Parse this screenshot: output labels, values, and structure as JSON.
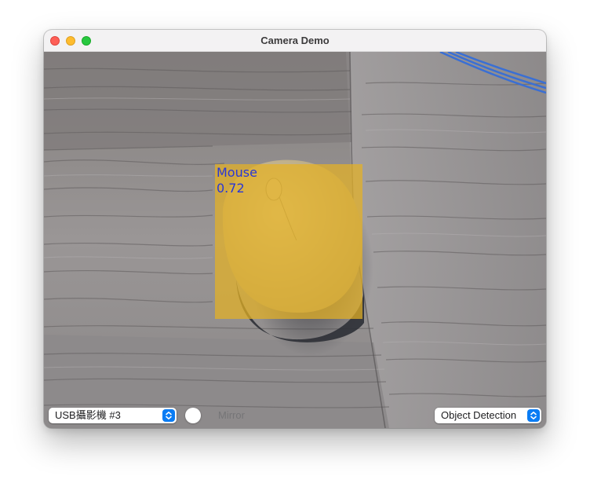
{
  "window": {
    "title": "Camera Demo"
  },
  "camera_view": {
    "detection": {
      "label": "Mouse",
      "score": "0.72",
      "box_color": "#e4b224",
      "text_color": "#2837d8"
    }
  },
  "controls": {
    "camera_select": {
      "selected": "USB攝影機 #3",
      "icon": "up-down-chevron-icon"
    },
    "mirror": {
      "label": "Mirror",
      "state": "off"
    },
    "mode_select": {
      "selected": "Object Detection",
      "icon": "up-down-chevron-icon"
    }
  },
  "colors": {
    "accent": "#0a7cf4",
    "close": "#fe5f57",
    "minimize": "#febc2e",
    "maximize": "#28c840"
  }
}
